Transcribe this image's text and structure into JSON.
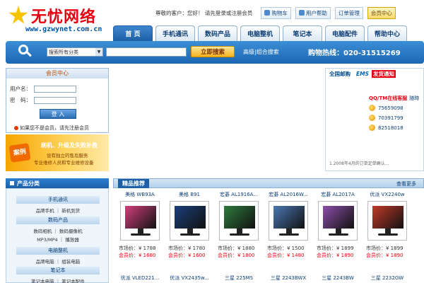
{
  "brand": {
    "name": "无忧网络",
    "url": "www.gzwynet.com.cn",
    "color": "#e60012"
  },
  "topbar": {
    "welcome": "尊敬的客户：您好！ 请先登录或注册会员",
    "cart": "购物车",
    "help": "用户帮助",
    "orders": "订单管理",
    "member": "会员中心"
  },
  "nav": {
    "tabs": [
      "首 页",
      "手机通讯",
      "数码产品",
      "电脑整机",
      "笔记本",
      "电脑配件",
      "帮助中心"
    ],
    "active": 0
  },
  "search": {
    "category": "搜索所有分类",
    "keyword": "",
    "button": "立即搜索",
    "advanced": "高级|组合搜索",
    "hotline": "购物热线：020-31515269"
  },
  "member_panel": {
    "title": "会员中心",
    "user_label": "用户名：",
    "pass_label": "密　码：",
    "login": "登 入",
    "register_tip": "如果您不是会员，请先注册会员"
  },
  "banner": {
    "seal": "案例",
    "line1": "刷机、升级及失败补救",
    "line2": "设有独立的售后服务",
    "line3": "专业维修人员和专业维修设备"
  },
  "ems": {
    "left": "全国邮购",
    "right": "EMS",
    "badge": "发货通知",
    "qq_title": "QQ/TM在线客服",
    "qq_tail": "随時",
    "qq": [
      "75659098",
      "70391799",
      "82518018"
    ],
    "note": "1.2008年4月的订单定单确认..."
  },
  "categories": {
    "title": "产品分类",
    "groups": [
      {
        "name": "手机通讯",
        "subs": "品牌手机 ｜ 新机到货"
      },
      {
        "name": "数码产品",
        "subs": "数码相机 ｜ 数码摄像机"
      },
      {
        "name": "",
        "subs": "MP3/MP4 ｜ 播放器"
      },
      {
        "name": "电脑整机",
        "subs": "品牌电脑 ｜ 组装电脑"
      },
      {
        "name": "笔记本",
        "subs": "笔记本电脑 ｜ 笔记本配件"
      }
    ]
  },
  "products": {
    "title": "精品推荐",
    "more": "查看更多",
    "price_label": "市场价：",
    "member_label": "会员价：",
    "items": [
      {
        "name": "美格 WB93A",
        "market": "¥ 1788",
        "member": "¥ 1680",
        "screen": "#d23f7b",
        "name2": "优派 VLED221..."
      },
      {
        "name": "美格 B91",
        "market": "¥ 1780",
        "member": "¥ 1600",
        "screen": "#1a3f7a",
        "name2": "优派 VX2435w..."
      },
      {
        "name": "宏碁 AL1916A...",
        "market": "¥ 1880",
        "member": "¥ 1800",
        "screen": "#2f7b3c",
        "name2": "三星 225MS"
      },
      {
        "name": "宏碁 AL2016W...",
        "market": "¥ 1500",
        "member": "¥ 1480",
        "screen": "#4a78b3",
        "name2": "三星 2243BWX"
      },
      {
        "name": "宏碁 AL2017A",
        "market": "¥ 1899",
        "member": "¥ 1890",
        "screen": "#8c4ea9",
        "name2": "三星 2243BW"
      },
      {
        "name": "优派 VX2240w",
        "market": "¥ 1899",
        "member": "¥ 1890",
        "screen": "#c23a2a",
        "name2": "三星 2232GW"
      }
    ]
  }
}
